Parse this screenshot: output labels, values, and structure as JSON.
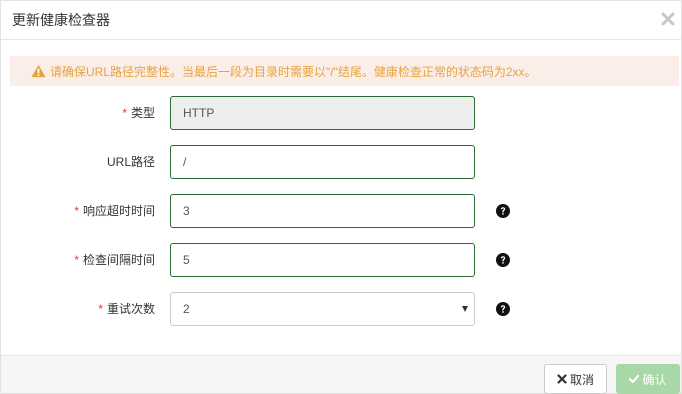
{
  "dialog": {
    "title": "更新健康检查器",
    "close_icon": "close-icon"
  },
  "alert": {
    "icon": "warning-icon",
    "text": "请确保URL路径完整性。当最后一段为目录时需要以\"/\"结尾。健康检查正常的状态码为2xx。",
    "color": "#e8a33d",
    "background": "#fbeee8"
  },
  "form": {
    "required_mark": "*",
    "type": {
      "label": "类型",
      "value": "HTTP",
      "required": true
    },
    "url_path": {
      "label": "URL路径",
      "value": "/",
      "required": false
    },
    "timeout": {
      "label": "响应超时时间",
      "value": "3",
      "required": true,
      "help_icon": "question-circle-icon"
    },
    "interval": {
      "label": "检查间隔时间",
      "value": "5",
      "required": true,
      "help_icon": "question-circle-icon"
    },
    "retries": {
      "label": "重试次数",
      "selected": "2",
      "required": true,
      "help_icon": "question-circle-icon"
    }
  },
  "footer": {
    "cancel_label": "取消",
    "cancel_icon": "times-icon",
    "confirm_label": "确认",
    "confirm_icon": "check-icon",
    "confirm_color": "#a8d8a8"
  }
}
